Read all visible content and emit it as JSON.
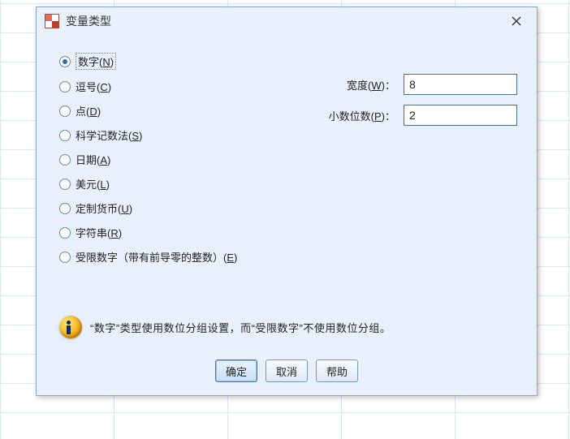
{
  "dialog": {
    "title": "变量类型"
  },
  "radios": {
    "numeric": {
      "label": "数字(",
      "mn": "N",
      "tail": ")",
      "selected": true
    },
    "comma": {
      "label": "逗号(",
      "mn": "C",
      "tail": ")",
      "selected": false
    },
    "dot": {
      "label": "点(",
      "mn": "D",
      "tail": ")",
      "selected": false
    },
    "sci": {
      "label": "科学记数法(",
      "mn": "S",
      "tail": ")",
      "selected": false
    },
    "date": {
      "label": "日期(",
      "mn": "A",
      "tail": ")",
      "selected": false
    },
    "dollar": {
      "label": "美元(",
      "mn": "L",
      "tail": ")",
      "selected": false
    },
    "ccurrency": {
      "label": "定制货币(",
      "mn": "U",
      "tail": ")",
      "selected": false
    },
    "string": {
      "label": "字符串(",
      "mn": "R",
      "tail": ")",
      "selected": false
    },
    "restricted": {
      "label": "受限数字（带有前导零的整数）(",
      "mn": "E",
      "tail": ")",
      "selected": false
    }
  },
  "fields": {
    "width": {
      "label_pre": "宽度(",
      "mn": "W",
      "label_post": ")：",
      "value": "8"
    },
    "decimals": {
      "label_pre": "小数位数(",
      "mn": "P",
      "label_post": ")：",
      "value": "2"
    }
  },
  "info": {
    "text": "“数字”类型使用数位分组设置，而“受限数字”不使用数位分组。"
  },
  "buttons": {
    "ok": "确定",
    "cancel": "取消",
    "help": "帮助"
  }
}
